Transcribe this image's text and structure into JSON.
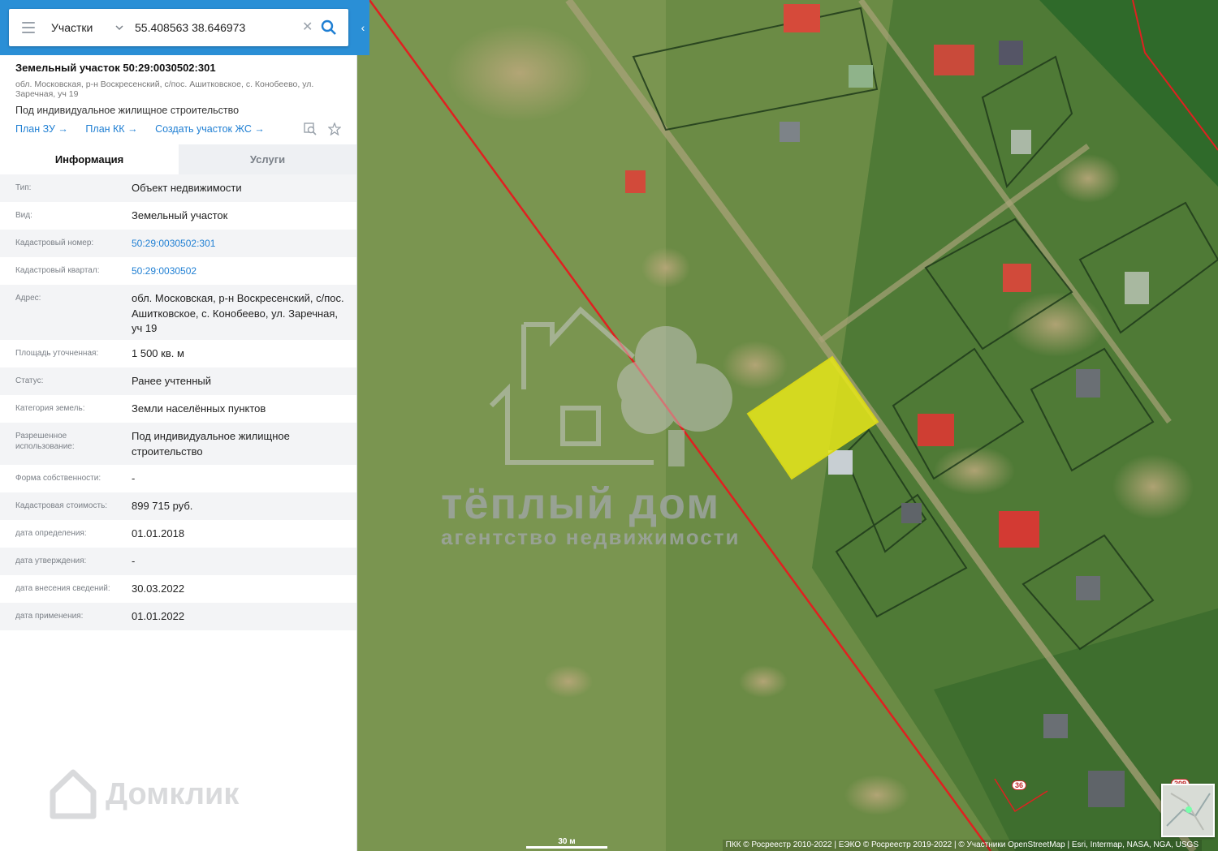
{
  "search": {
    "layer": "Участки",
    "coords": "55.408563 38.646973",
    "clear_icon": "close-icon",
    "search_icon": "search-icon"
  },
  "parcel": {
    "title": "Земельный участок 50:29:0030502:301",
    "address": "обл. Московская, р-н Воскресенский, с/пос. Ашитковское, с. Конобеево, ул. Заречная, уч 19",
    "use": "Под индивидуальное жилищное строительство",
    "links": [
      "План ЗУ →",
      "План КК →",
      "Создать участок ЖС →"
    ]
  },
  "tabs": [
    "Информация",
    "Услуги"
  ],
  "info_rows": [
    {
      "label": "Тип:",
      "value": "Объект недвижимости"
    },
    {
      "label": "Вид:",
      "value": "Земельный участок"
    },
    {
      "label": "Кадастровый номер:",
      "value": "50:29:0030502:301",
      "link": true
    },
    {
      "label": "Кадастровый квартал:",
      "value": "50:29:0030502",
      "link": true
    },
    {
      "label": "Адрес:",
      "value": "обл. Московская, р-н Воскресенский, с/пос. Ашитковское, с. Конобеево, ул. Заречная, уч 19"
    },
    {
      "label": "Площадь уточненная:",
      "value": "1 500 кв. м"
    },
    {
      "label": "Статус:",
      "value": "Ранее учтенный"
    },
    {
      "label": "Категория земель:",
      "value": "Земли населённых пунктов"
    },
    {
      "label": "Разрешенное использование:",
      "value": "Под индивидуальное жилищное строительство"
    },
    {
      "label": "Форма собственности:",
      "value": "-"
    },
    {
      "label": "Кадастровая стоимость:",
      "value": "899 715 руб."
    },
    {
      "label": "дата определения:",
      "value": "01.01.2018"
    },
    {
      "label": "дата утверждения:",
      "value": "-"
    },
    {
      "label": "дата внесения сведений:",
      "value": "30.03.2022"
    },
    {
      "label": "дата применения:",
      "value": "01.01.2022"
    }
  ],
  "branding": {
    "domclick": "Домклик",
    "watermark_title": "тёплый дом",
    "watermark_sub": "агентство недвижимости"
  },
  "map": {
    "scale": "30 м",
    "attribution": "ПКК © Росреестр 2010-2022 | ЕЭКО © Росреестр 2019-2022 | © Участники OpenStreetMap | Esri, Intermap, NASA, NGA, USGS",
    "road_labels": [
      "36",
      "209"
    ],
    "colors": {
      "highlight": "#e6e61a",
      "boundary": "#e02020",
      "accent": "#2a8fd6"
    }
  }
}
